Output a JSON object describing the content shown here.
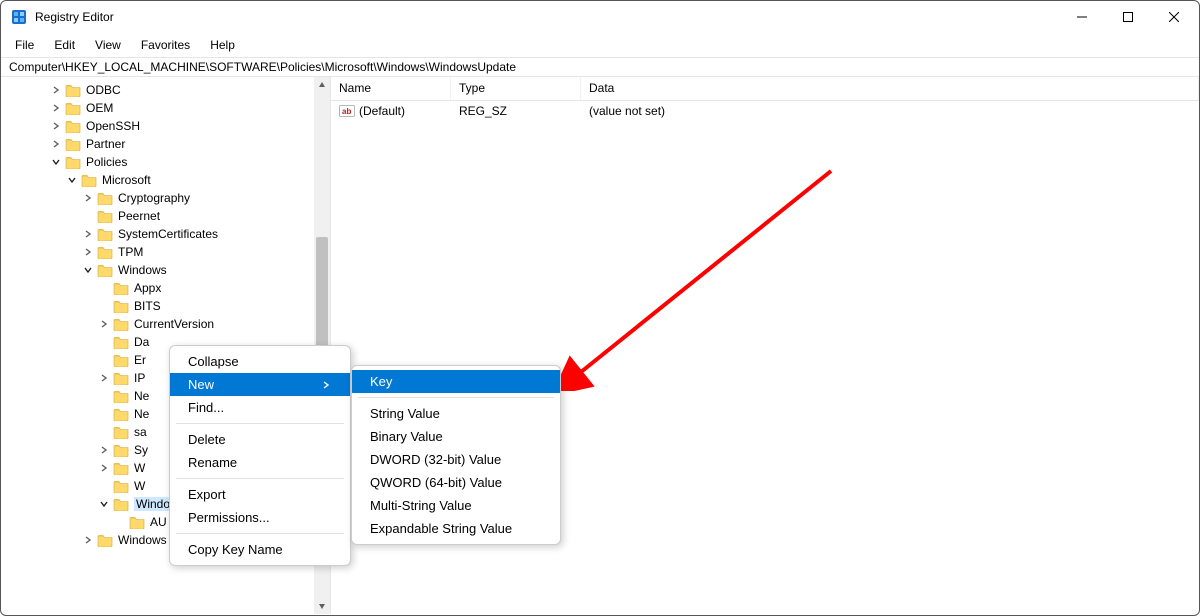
{
  "titlebar": {
    "title": "Registry Editor"
  },
  "menubar": {
    "items": [
      "File",
      "Edit",
      "View",
      "Favorites",
      "Help"
    ]
  },
  "addressbar": {
    "path": "Computer\\HKEY_LOCAL_MACHINE\\SOFTWARE\\Policies\\Microsoft\\Windows\\WindowsUpdate"
  },
  "tree": {
    "items": [
      {
        "indent": 0,
        "chev": "right",
        "label": "ODBC"
      },
      {
        "indent": 0,
        "chev": "right",
        "label": "OEM"
      },
      {
        "indent": 0,
        "chev": "right",
        "label": "OpenSSH"
      },
      {
        "indent": 0,
        "chev": "right",
        "label": "Partner"
      },
      {
        "indent": 0,
        "chev": "down",
        "label": "Policies"
      },
      {
        "indent": 1,
        "chev": "down",
        "label": "Microsoft"
      },
      {
        "indent": 2,
        "chev": "right",
        "label": "Cryptography"
      },
      {
        "indent": 2,
        "chev": "none",
        "label": "Peernet"
      },
      {
        "indent": 2,
        "chev": "right",
        "label": "SystemCertificates"
      },
      {
        "indent": 2,
        "chev": "right",
        "label": "TPM"
      },
      {
        "indent": 2,
        "chev": "down",
        "label": "Windows"
      },
      {
        "indent": 3,
        "chev": "none",
        "label": "Appx"
      },
      {
        "indent": 3,
        "chev": "none",
        "label": "BITS"
      },
      {
        "indent": 3,
        "chev": "right",
        "label": "CurrentVersion"
      },
      {
        "indent": 3,
        "chev": "none",
        "label": "Da"
      },
      {
        "indent": 3,
        "chev": "none",
        "label": "Er"
      },
      {
        "indent": 3,
        "chev": "right",
        "label": "IP"
      },
      {
        "indent": 3,
        "chev": "none",
        "label": "Ne"
      },
      {
        "indent": 3,
        "chev": "none",
        "label": "Ne"
      },
      {
        "indent": 3,
        "chev": "none",
        "label": "sa"
      },
      {
        "indent": 3,
        "chev": "right",
        "label": "Sy"
      },
      {
        "indent": 3,
        "chev": "right",
        "label": "W"
      },
      {
        "indent": 3,
        "chev": "none",
        "label": "W"
      },
      {
        "indent": 3,
        "chev": "down",
        "label": "WindowsUpdate",
        "selected": true
      },
      {
        "indent": 4,
        "chev": "none",
        "label": "AU"
      },
      {
        "indent": 2,
        "chev": "right",
        "label": "Windows Defender"
      }
    ]
  },
  "list": {
    "cols": {
      "name": "Name",
      "type": "Type",
      "data": "Data"
    },
    "rows": [
      {
        "name": "(Default)",
        "type": "REG_SZ",
        "data": "(value not set)"
      }
    ]
  },
  "contextMenu1": {
    "items": [
      {
        "label": "Collapse"
      },
      {
        "label": "New",
        "highlight": true,
        "submenu": true
      },
      {
        "label": "Find..."
      },
      {
        "sep": true
      },
      {
        "label": "Delete"
      },
      {
        "label": "Rename"
      },
      {
        "sep": true
      },
      {
        "label": "Export"
      },
      {
        "label": "Permissions..."
      },
      {
        "sep": true
      },
      {
        "label": "Copy Key Name"
      }
    ]
  },
  "contextMenu2": {
    "items": [
      {
        "label": "Key",
        "highlight": true
      },
      {
        "sep": true
      },
      {
        "label": "String Value"
      },
      {
        "label": "Binary Value"
      },
      {
        "label": "DWORD (32-bit) Value"
      },
      {
        "label": "QWORD (64-bit) Value"
      },
      {
        "label": "Multi-String Value"
      },
      {
        "label": "Expandable String Value"
      }
    ]
  }
}
